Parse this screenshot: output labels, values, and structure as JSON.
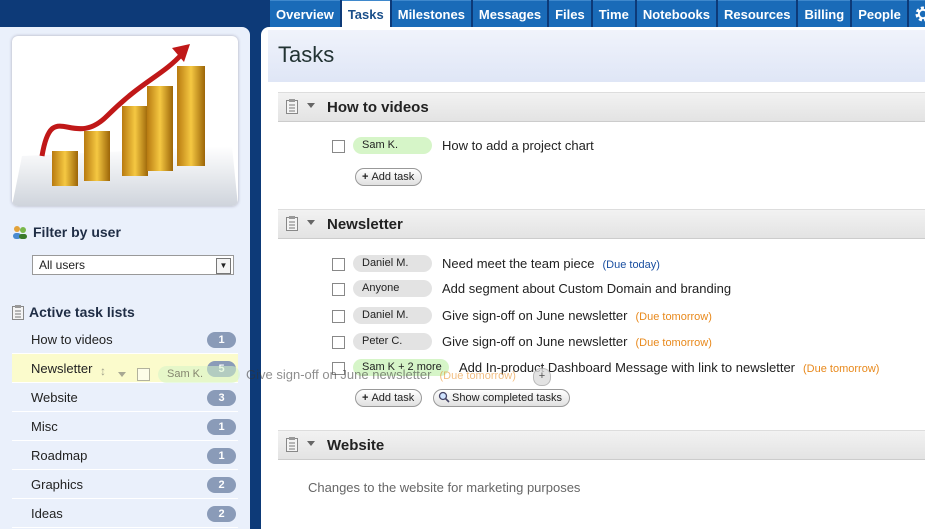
{
  "nav": {
    "tabs": [
      "Overview",
      "Tasks",
      "Milestones",
      "Messages",
      "Files",
      "Time",
      "Notebooks",
      "Resources",
      "Billing",
      "People"
    ],
    "active": "Tasks",
    "gear_icon": "gear-icon"
  },
  "sidebar": {
    "filter_heading": "Filter by user",
    "user_select_value": "All users",
    "lists_heading": "Active task lists",
    "lists": [
      {
        "name": "How to videos",
        "count": "1"
      },
      {
        "name": "Newsletter",
        "count": "5"
      },
      {
        "name": "Website",
        "count": "3"
      },
      {
        "name": "Misc",
        "count": "1"
      },
      {
        "name": "Roadmap",
        "count": "1"
      },
      {
        "name": "Graphics",
        "count": "2"
      },
      {
        "name": "Ideas",
        "count": "2"
      }
    ]
  },
  "main": {
    "title": "Tasks",
    "sections": {
      "howto": {
        "title": "How to videos",
        "tasks": [
          {
            "assignee": "Sam K.",
            "text": "How to add a project chart",
            "due": ""
          }
        ],
        "add_task_label": "Add task"
      },
      "newsletter": {
        "title": "Newsletter",
        "tasks": [
          {
            "assignee": "Daniel M.",
            "text": "Need meet the team piece",
            "due": "(Due today)"
          },
          {
            "assignee": "Anyone",
            "text": "Add segment about Custom Domain and branding",
            "due": ""
          },
          {
            "assignee": "Daniel M.",
            "text": "Give sign-off on June newsletter",
            "due": "(Due tomorrow)"
          },
          {
            "assignee": "Peter C.",
            "text": "Give sign-off on June newsletter",
            "due": "(Due tomorrow)"
          },
          {
            "assignee": "Sam K + 2 more",
            "text": "Add In-product Dashboard Message with link to newsletter",
            "due": "(Due tomorrow)"
          }
        ],
        "add_task_label": "Add task",
        "show_completed_label": "Show completed tasks"
      },
      "website": {
        "title": "Website",
        "description": "Changes to the website for marketing purposes"
      }
    }
  },
  "drag_ghost": {
    "assignee": "Sam K.",
    "text": "Give sign-off on June newsletter",
    "due": "(Due tomorrow)"
  },
  "colors": {
    "nav_tab": "#1a6bb8",
    "background": "#0d3a78",
    "badge": "#8a9bb8",
    "due_today": "#1a4fa0",
    "due_tomorrow": "#e8891c",
    "assignee_green": "#d6f5c8"
  }
}
